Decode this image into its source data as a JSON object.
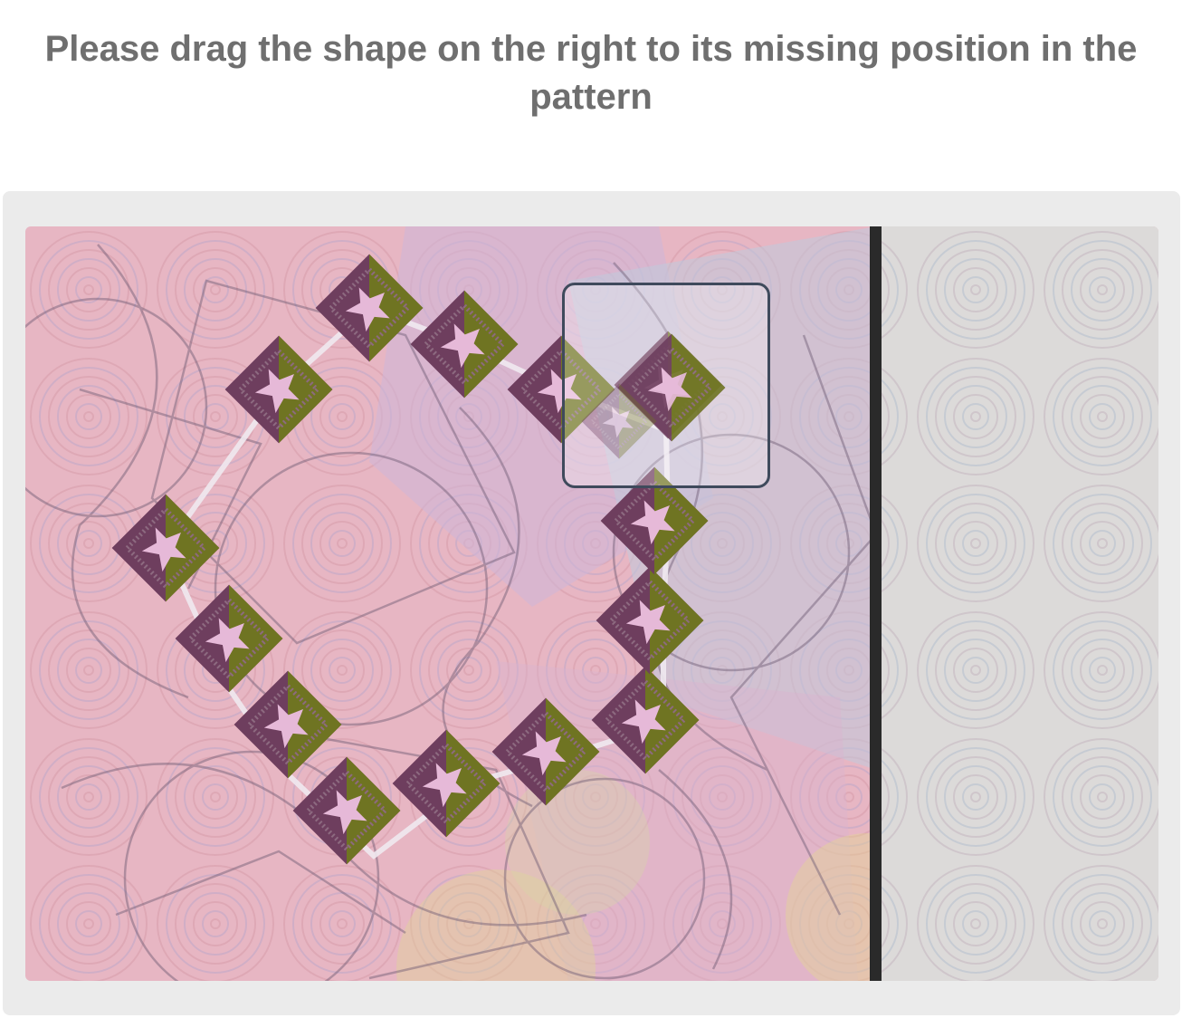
{
  "instruction": "Please drag the shape on the right to its missing position in the pattern",
  "colors": {
    "text": "#6f6f6f",
    "panel_bg": "#ebebeb",
    "drag_box_border": "#3f4a5c",
    "divider": "#2a2a2a",
    "tile_dark": "#6e3e5e",
    "tile_green": "#6f7a1c",
    "star": "#e6b9d8"
  },
  "icons": [
    "star-tile-icon"
  ]
}
